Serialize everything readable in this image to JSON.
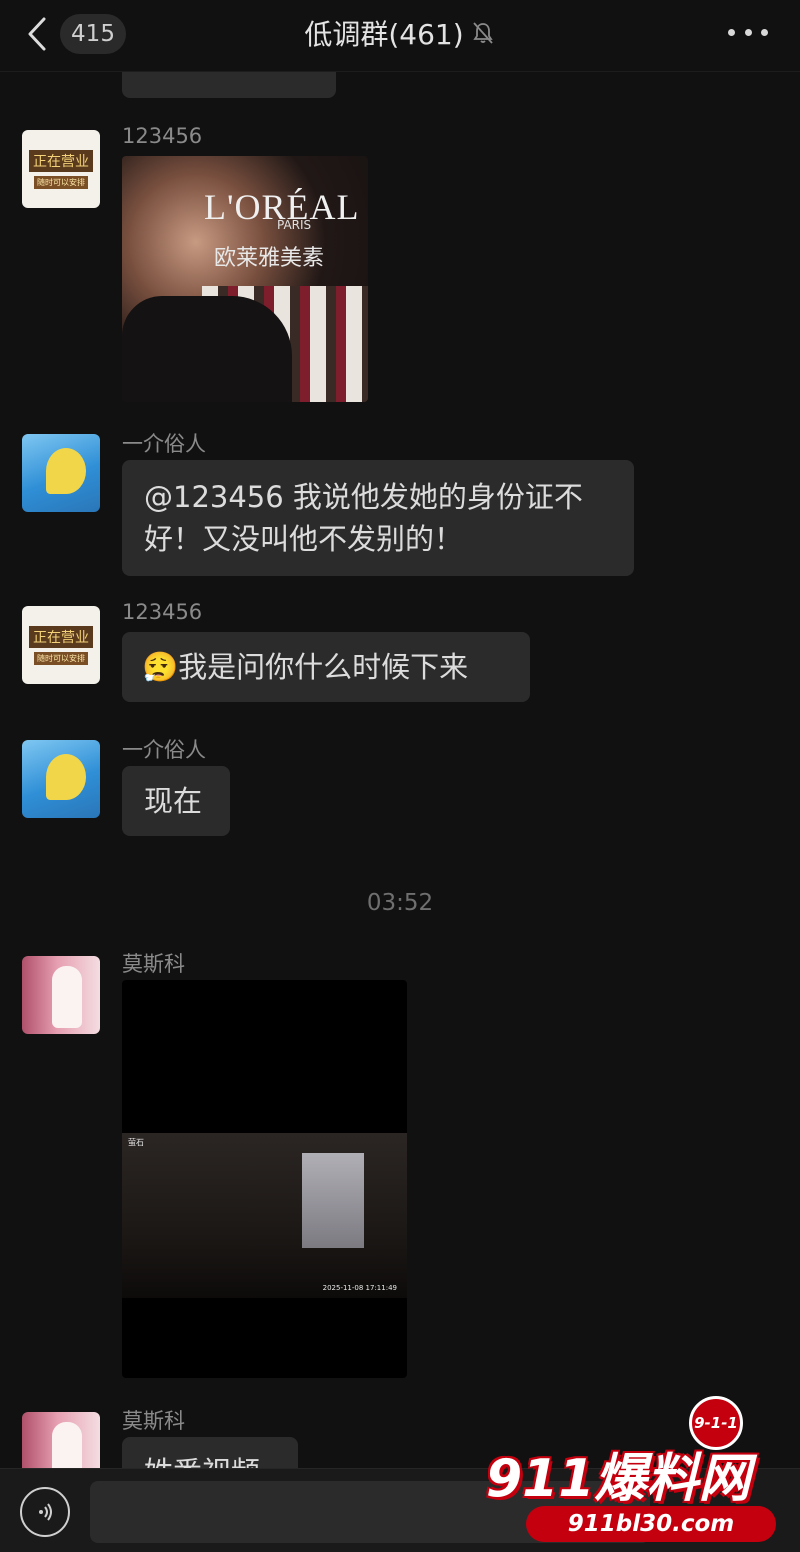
{
  "header": {
    "unread_count": "415",
    "title": "低调群(461)",
    "back_icon": "chevron-left-icon",
    "mute_icon": "bell-off-icon",
    "more_icon": "more-dots-icon"
  },
  "avatars": {
    "shop_sign_line1": "正在营业",
    "shop_sign_line2": "随时可以安排"
  },
  "messages": [
    {
      "sender": "123456",
      "type": "image",
      "image_text_brand": "L'ORÉAL",
      "image_text_city": "PARIS",
      "image_text_cn": "欧莱雅美素"
    },
    {
      "sender": "一介俗人",
      "type": "text",
      "text": "@123456 我说他发她的身份证不好！又没叫他不发别的！"
    },
    {
      "sender": "123456",
      "type": "text",
      "emoji": "😮‍💨",
      "text": "我是问你什么时候下来"
    },
    {
      "sender": "一介俗人",
      "type": "text",
      "text": "现在"
    },
    {
      "type": "timestamp",
      "text": "03:52"
    },
    {
      "sender": "莫斯科",
      "type": "video",
      "overlay_brand": "萤石",
      "overlay_time": "2025-11-08 17:11:49"
    },
    {
      "sender": "莫斯科",
      "type": "text",
      "text": "姓番视频"
    }
  ],
  "input": {
    "voice_icon": "voice-icon",
    "placeholder": ""
  },
  "watermark": {
    "badge": "9-1-1",
    "logo": "911爆料网",
    "url": "911bl30.com"
  }
}
